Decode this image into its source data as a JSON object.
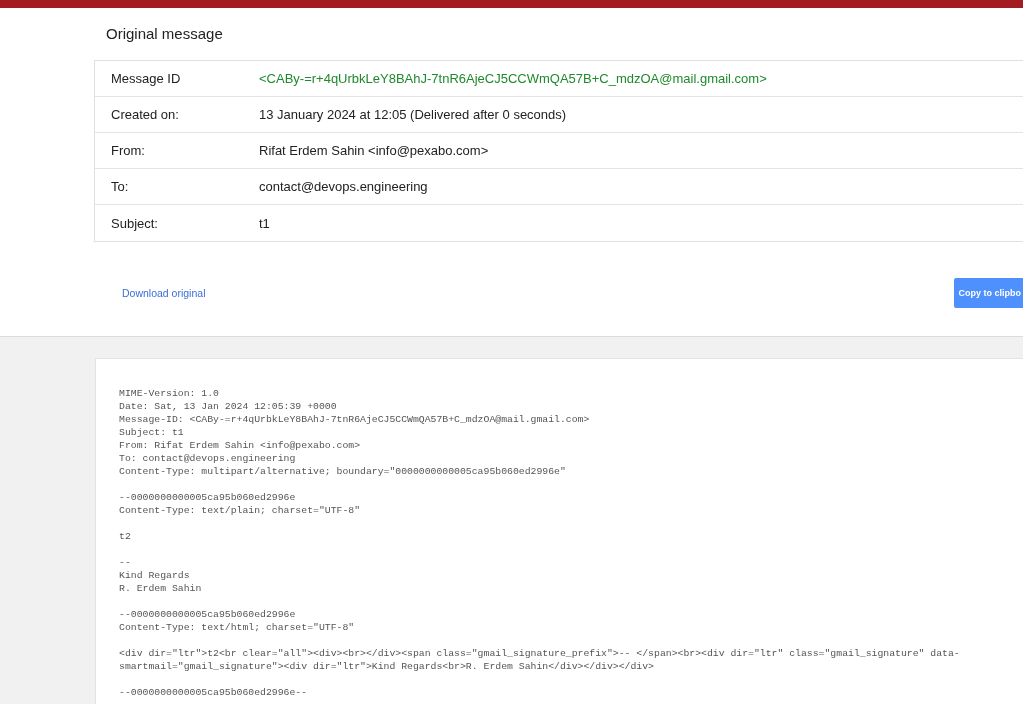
{
  "title": "Original message",
  "details": [
    {
      "label": "Message ID",
      "value": "<CABy-=r+4qUrbkLeY8BAhJ-7tnR6AjeCJ5CCWmQA57B+C_mdzOA@mail.gmail.com>",
      "kind": "id"
    },
    {
      "label": "Created on:",
      "value": "13 January 2024 at 12:05 (Delivered after 0 seconds)",
      "kind": "text"
    },
    {
      "label": "From:",
      "value": "Rifat Erdem Sahin <info@pexabo.com>",
      "kind": "text"
    },
    {
      "label": "To:",
      "value": "contact@devops.engineering",
      "kind": "text"
    },
    {
      "label": "Subject:",
      "value": "t1",
      "kind": "text"
    }
  ],
  "actions": {
    "download_link": "Download original",
    "copy_button": "Copy to clipbo"
  },
  "raw_source": "MIME-Version: 1.0\nDate: Sat, 13 Jan 2024 12:05:39 +0000\nMessage-ID: <CABy-=r+4qUrbkLeY8BAhJ-7tnR6AjeCJ5CCWmQA57B+C_mdzOA@mail.gmail.com>\nSubject: t1\nFrom: Rifat Erdem Sahin <info@pexabo.com>\nTo: contact@devops.engineering\nContent-Type: multipart/alternative; boundary=\"0000000000005ca95b060ed2996e\"\n\n--0000000000005ca95b060ed2996e\nContent-Type: text/plain; charset=\"UTF-8\"\n\nt2\n\n--\nKind Regards\nR. Erdem Sahin\n\n--0000000000005ca95b060ed2996e\nContent-Type: text/html; charset=\"UTF-8\"\n\n<div dir=\"ltr\">t2<br clear=\"all\"><div><br></div><span class=\"gmail_signature_prefix\">-- </span><br><div dir=\"ltr\" class=\"gmail_signature\" data-smartmail=\"gmail_signature\"><div dir=\"ltr\">Kind Regards<br>R. Erdem Sahin</div></div></div>\n\n--0000000000005ca95b060ed2996e--"
}
